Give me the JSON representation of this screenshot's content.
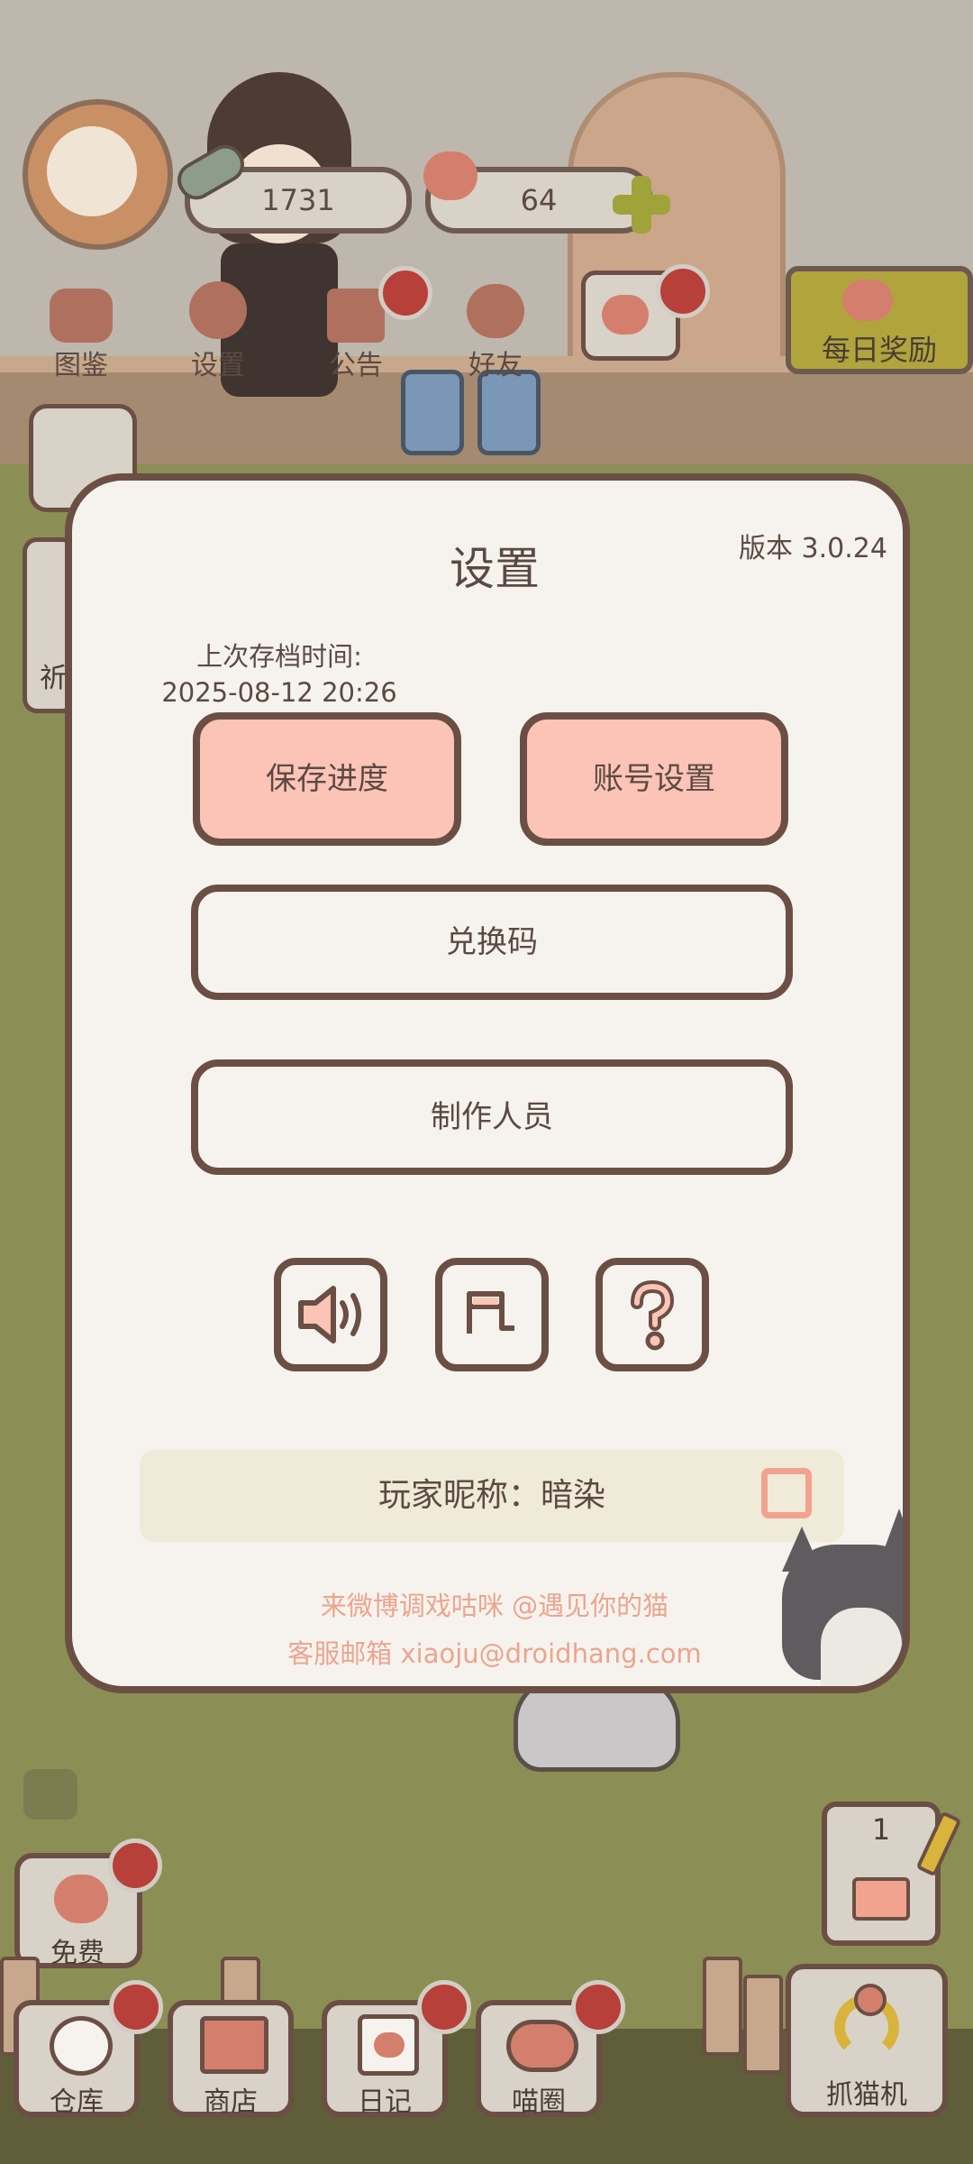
{
  "hud": {
    "fish_count": "1731",
    "heart_count": "64",
    "menu": [
      {
        "label": "图鉴"
      },
      {
        "label": "设置"
      },
      {
        "label": "公告"
      },
      {
        "label": "好友"
      }
    ],
    "daily_reward": "每日奖励"
  },
  "dialog": {
    "title": "设置",
    "version": "版本 3.0.24",
    "save_time_label": "上次存档时间:",
    "save_time_value": "2025-08-12 20:26",
    "save_button": "保存进度",
    "account_button": "账号设置",
    "redeem_button": "兑换码",
    "credits_button": "制作人员",
    "nickname": "玩家昵称：暗染",
    "weibo_line": "来微博调戏咕咪 @遇见你的猫",
    "email_line": "客服邮箱 xiaoju@droidhang.com"
  },
  "left_partial_label": "祈",
  "bottom": {
    "free": "免费",
    "warehouse": "仓库",
    "shop": "商店",
    "diary": "日记",
    "meow_circle": "喵圈",
    "claw_machine": "抓猫机",
    "claw_count": "1"
  },
  "colors": {
    "accent_pink": "#fcc4b7",
    "border_brown": "#6b4f44",
    "badge_red": "#b8403a",
    "footer_salmon": "#eba58f"
  }
}
